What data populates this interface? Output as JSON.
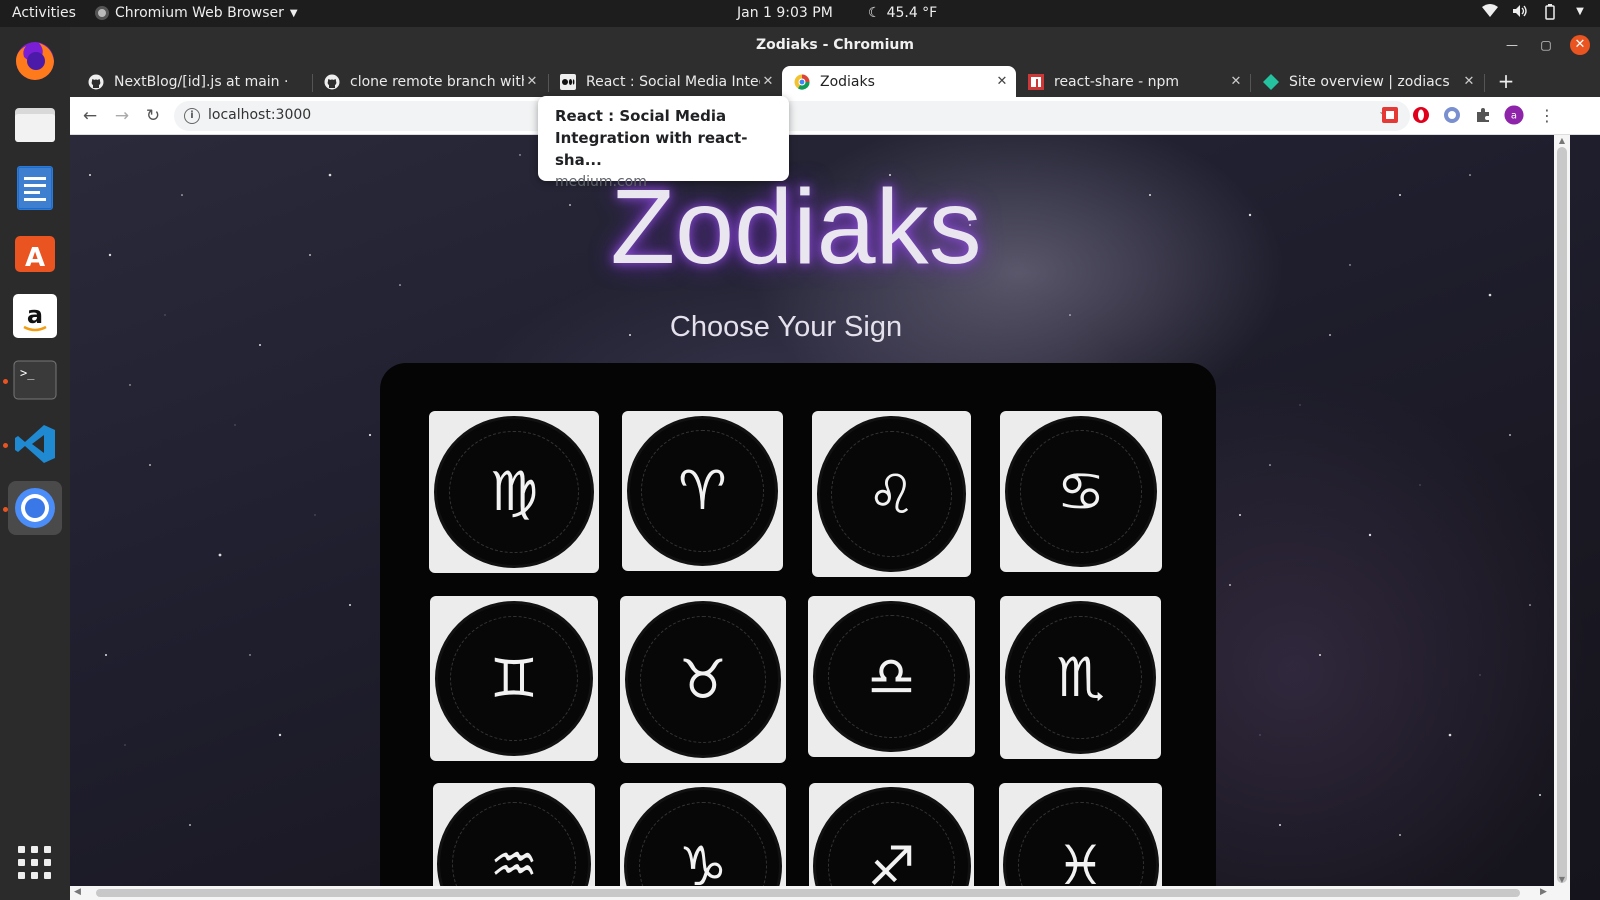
{
  "topbar": {
    "activities": "Activities",
    "app_name": "Chromium Web Browser",
    "clock": "Jan 1   9:03 PM",
    "weather": "45.4 °F"
  },
  "dock": {
    "items": [
      "Firefox",
      "Files",
      "LibreOffice Writer",
      "Ubuntu Software",
      "Amazon",
      "Terminal",
      "Visual Studio Code",
      "Chromium"
    ]
  },
  "window": {
    "title": "Zodiaks - Chromium"
  },
  "tabs": [
    {
      "title": "NextBlog/[id].js at main ·",
      "favicon": "github-icon"
    },
    {
      "title": "clone remote branch with",
      "favicon": "github-icon"
    },
    {
      "title": "React : Social Media Integ",
      "favicon": "medium-icon"
    },
    {
      "title": "Zodiaks",
      "favicon": "chromium-icon",
      "active": true
    },
    {
      "title": "react-share - npm",
      "favicon": "npm-icon"
    },
    {
      "title": "Site overview | zodiacs",
      "favicon": "netlify-icon"
    }
  ],
  "toolbar": {
    "url": "localhost:3000"
  },
  "tooltip": {
    "title": "React : Social Media Integration with react-sha...",
    "domain": "medium.com"
  },
  "page": {
    "title": "Zodiaks",
    "subtitle": "Choose Your Sign",
    "signs": [
      {
        "name": "Virgo",
        "glyph": "♍"
      },
      {
        "name": "Aries",
        "glyph": "♈"
      },
      {
        "name": "Leo",
        "glyph": "♌"
      },
      {
        "name": "Cancer",
        "glyph": "♋"
      },
      {
        "name": "Gemini",
        "glyph": "♊"
      },
      {
        "name": "Taurus",
        "glyph": "♉"
      },
      {
        "name": "Libra",
        "glyph": "♎"
      },
      {
        "name": "Scorpio",
        "glyph": "♏"
      },
      {
        "name": "Aquarius",
        "glyph": "♒"
      },
      {
        "name": "Capricorn",
        "glyph": "♑"
      },
      {
        "name": "Sagittarius",
        "glyph": "♐"
      },
      {
        "name": "Pisces",
        "glyph": "♓"
      }
    ]
  },
  "colors": {
    "ubuntu_orange": "#e95420",
    "title_glow": "#7b2fd0",
    "panel": "#050505"
  }
}
